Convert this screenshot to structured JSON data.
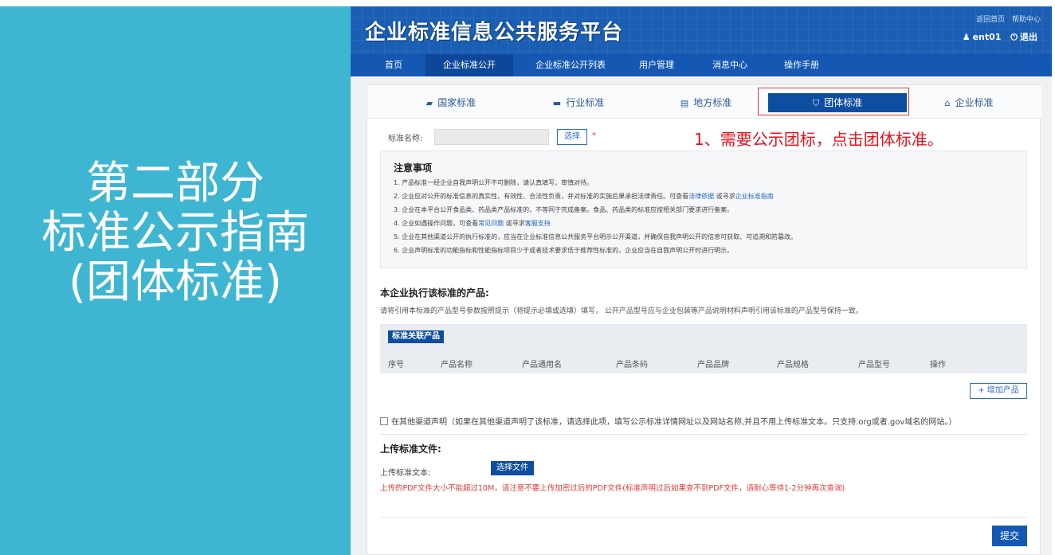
{
  "slide": {
    "title_lines": [
      "第二部分",
      "标准公示指南",
      "(团体标准)"
    ]
  },
  "platform": {
    "logo": "企业标准信息公共服务平台",
    "top_links": [
      "返回首页",
      "帮助中心"
    ],
    "user": "ent01",
    "logout": "退出",
    "user_icon": "person-icon",
    "logout_icon": "power-icon"
  },
  "nav": {
    "items": [
      "首页",
      "企业标准公开",
      "企业标准公开列表",
      "用户管理",
      "消息中心",
      "操作手册"
    ],
    "active_index": 1
  },
  "tabs": {
    "items": [
      {
        "label": "国家标准",
        "icon": "book-icon",
        "glyph": "▰"
      },
      {
        "label": "行业标准",
        "icon": "briefcase-icon",
        "glyph": "▬"
      },
      {
        "label": "地方标准",
        "icon": "document-icon",
        "glyph": "▤"
      },
      {
        "label": "团体标准",
        "icon": "shield-icon",
        "glyph": "⛉"
      },
      {
        "label": "企业标准",
        "icon": "bank-icon",
        "glyph": "⌂"
      }
    ],
    "active_index": 3
  },
  "form": {
    "name_label": "标准名称:",
    "select_label": "选择",
    "required_mark": "*",
    "annotation": "1、需要公示团标，点击团体标准。"
  },
  "notice": {
    "title": "注意事项",
    "lines": [
      {
        "text": "1. 产品标准一经企业自我声明公开不可删除，请认真填写，审慎对待。"
      },
      {
        "text": "2. 企业应对公开的标准信息的真实性、有效性、合法性负责，并对标准的实施后果承担法律责任。可查看",
        "link1": "法律依据",
        "mid": " 或寻求",
        "link2": "企业标准指南"
      },
      {
        "text": "3. 企业在本平台公开食品类、药品类产品标准的，不等同于完成备案。食品、药品类的标准应按相关部门要求进行备案。"
      },
      {
        "text": "4. 企业如遇操作问题，可查看",
        "link1": "常见问题",
        "mid": " 或寻求",
        "link2": "客服支持"
      },
      {
        "text": "5. 企业在其他渠道公开的执行标准的，应当在企业标准信息公共服务平台明示公开渠道，并确保自我声明公开的信息可获取、可追溯和防篡改。"
      },
      {
        "text": "6. 企业声明标准的功能指标和性能指标项目少于或者技术要求低于推荐性标准的，企业应当在自我声明公开时进行明示。"
      }
    ]
  },
  "products": {
    "title": "本企业执行该标准的产品:",
    "hint": "请将引用本标准的产品型号参数按照提示（将提示必填或选填）填写， 公开产品型号应与企业包装等产品说明材料声明引用该标准的产品型号保持一致。",
    "tag": "标准关联产品",
    "columns": [
      "序号",
      "产品名称",
      "产品通用名",
      "产品条码",
      "产品品牌",
      "产品规格",
      "产品型号",
      "操作"
    ],
    "add_button": "+ 增加产品"
  },
  "other_channel": {
    "label": "在其他渠道声明（如果在其他渠道声明了该标准，请选择此项，填写公示标准详情网址以及网站名称,并且不用上传标准文本。只支持.org或者.gov域名的网站。）",
    "checked": false
  },
  "upload": {
    "title": "上传标准文件:",
    "label": "上传标准文本:",
    "button": "选择文件",
    "note": "上传的PDF文件大小不能超过10M，请注意不要上传加密过后的PDF文件(标准声明过后如果查不到PDF文件，请耐心等待1-2分钟再次查询)"
  },
  "submit": "提交",
  "colors": {
    "slide_bg": "#3fb6d1",
    "brand_blue": "#1458b3",
    "active_tab": "#0e4ea0",
    "annotation_red": "#e8101b"
  }
}
